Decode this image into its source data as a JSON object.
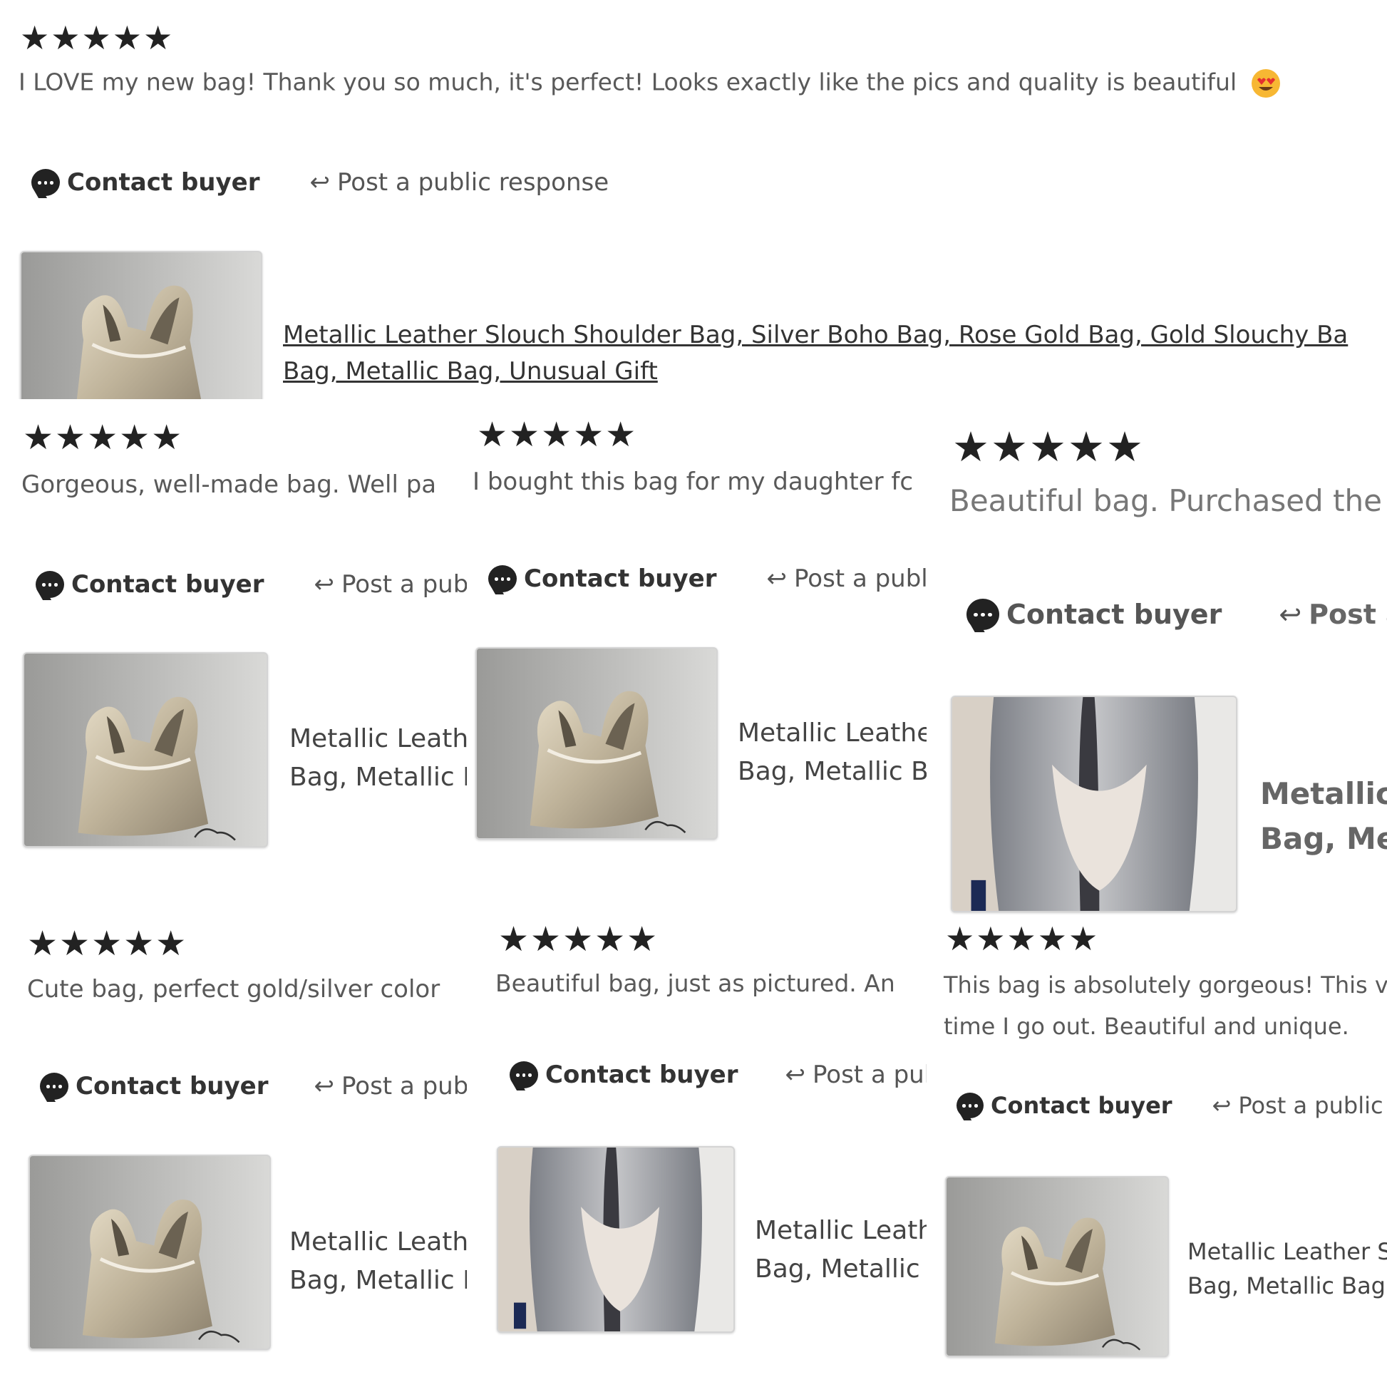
{
  "colors": {
    "text_dark": "#222222",
    "text_muted": "#595959",
    "star": "#222222",
    "photo_bg": "#c8c8c6"
  },
  "reviews": [
    {
      "stars": "★★★★★",
      "text": "I LOVE my new bag! Thank you so much, it's perfect! Looks exactly like the pics and quality is beautiful",
      "emoji": "heart-eyes-emoji",
      "contact_label": "Contact buyer",
      "post_label": "Post a public response",
      "product_title_line1": "Metallic Leather Slouch Shoulder Bag, Silver Boho Bag, Rose Gold Bag, Gold Slouchy Ba",
      "product_title_line2": "Bag, Metallic Bag, Unusual Gift",
      "thumb_kind": "tote"
    },
    {
      "stars": "★★★★★",
      "text": "Gorgeous, well-made bag. Well pa",
      "contact_label": "Contact buyer",
      "post_label": "Post a publi",
      "product_title_line1": "Metallic Leath",
      "product_title_line2": "Bag, Metallic I",
      "thumb_kind": "tote"
    },
    {
      "stars": "★★★★★",
      "text": "I bought this bag for my daughter fc",
      "contact_label": "Contact buyer",
      "post_label": "Post a public",
      "product_title_line1": "Metallic Leathe",
      "product_title_line2": "Bag, Metallic B",
      "thumb_kind": "tote"
    },
    {
      "stars": "★★★★★",
      "text": "Beautiful bag. Purchased the",
      "contact_label": "Contact buyer",
      "post_label": "Post a",
      "product_title_line1": "Metallic",
      "product_title_line2": "Bag, Met",
      "thumb_kind": "model"
    },
    {
      "stars": "★★★★★",
      "text": "Cute bag, perfect gold/silver color",
      "contact_label": "Contact buyer",
      "post_label": "Post a publi",
      "product_title_line1": "Metallic Leath",
      "product_title_line2": "Bag, Metallic I",
      "thumb_kind": "tote"
    },
    {
      "stars": "★★★★★",
      "text": "Beautiful bag, just as pictured. An",
      "contact_label": "Contact buyer",
      "post_label": "Post a publi",
      "product_title_line1": "Metallic Leath",
      "product_title_line2": "Bag, Metallic I",
      "thumb_kind": "model"
    },
    {
      "stars": "★★★★★",
      "text": "This bag is absolutely gorgeous! This v",
      "text_line2": "time I go out. Beautiful and unique.",
      "contact_label": "Contact buyer",
      "post_label": "Post a public re",
      "product_title_line1": "Metallic Leather S",
      "product_title_line2": "Bag, Metallic Bag",
      "thumb_kind": "tote"
    }
  ]
}
